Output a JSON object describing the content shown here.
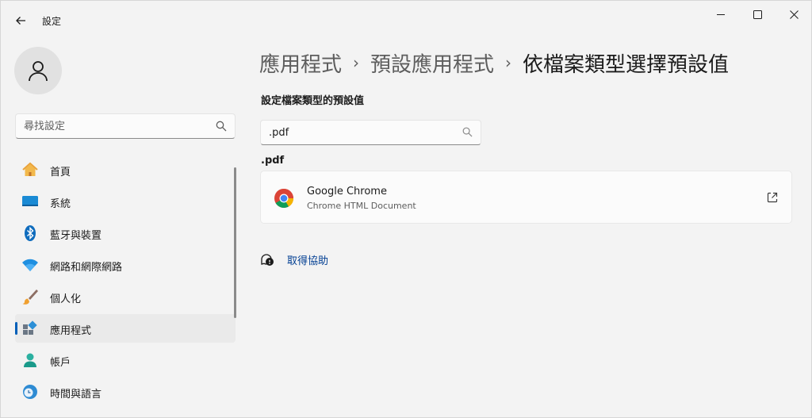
{
  "window": {
    "title": "設定",
    "controls": [
      "minimize-icon",
      "maximize-icon",
      "close-icon"
    ]
  },
  "sidebar": {
    "search_placeholder": "尋找設定",
    "items": [
      {
        "label": "首頁",
        "icon": "home-icon"
      },
      {
        "label": "系統",
        "icon": "system-icon"
      },
      {
        "label": "藍牙與裝置",
        "icon": "bluetooth-icon"
      },
      {
        "label": "網路和網際網路",
        "icon": "wifi-icon"
      },
      {
        "label": "個人化",
        "icon": "brush-icon"
      },
      {
        "label": "應用程式",
        "icon": "apps-icon",
        "active": true
      },
      {
        "label": "帳戶",
        "icon": "account-icon"
      },
      {
        "label": "時間與語言",
        "icon": "time-language-icon"
      }
    ]
  },
  "breadcrumb": {
    "items": [
      "應用程式",
      "預設應用程式",
      "依檔案類型選擇預設值"
    ],
    "separator": "›"
  },
  "main": {
    "section_title": "設定檔案類型的預設值",
    "filter_value": ".pdf",
    "extension_heading": ".pdf",
    "app": {
      "name": "Google Chrome",
      "description": "Chrome HTML Document",
      "icon": "chrome-icon"
    },
    "help_label": "取得協助"
  },
  "colors": {
    "background": "#f3f3f3",
    "accent": "#005fb8",
    "link": "#003e92"
  }
}
